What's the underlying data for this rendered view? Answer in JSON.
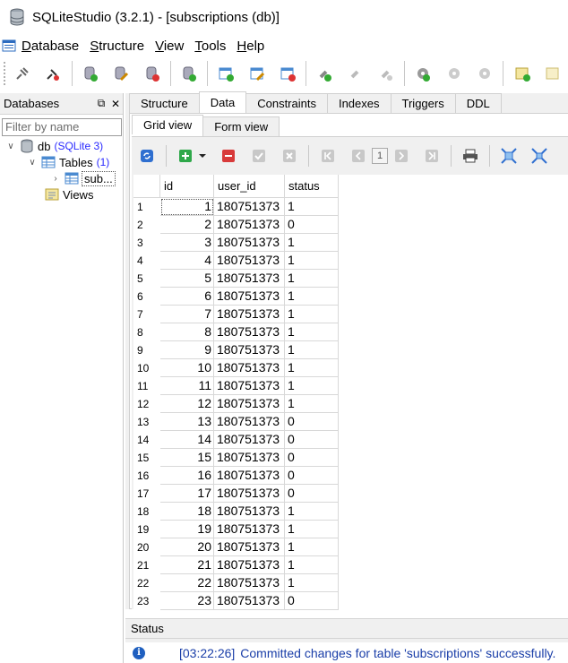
{
  "window": {
    "title": "SQLiteStudio (3.2.1) - [subscriptions (db)]"
  },
  "menu": [
    {
      "mn": "D",
      "rest": "atabase"
    },
    {
      "mn": "S",
      "rest": "tructure"
    },
    {
      "mn": "V",
      "rest": "iew"
    },
    {
      "mn": "T",
      "rest": "ools"
    },
    {
      "mn": "H",
      "rest": "elp"
    }
  ],
  "databases_panel": {
    "title": "Databases",
    "filter_placeholder": "Filter by name",
    "tree": {
      "db_name": "db",
      "db_type": "(SQLite 3)",
      "tables_label": "Tables",
      "tables_count": "(1)",
      "table_item": "sub...",
      "views_label": "Views"
    }
  },
  "tabs": [
    "Structure",
    "Data",
    "Constraints",
    "Indexes",
    "Triggers",
    "DDL"
  ],
  "active_tab": "Data",
  "inner_tabs": [
    "Grid view",
    "Form view"
  ],
  "grid_toolbar": {
    "page": "1"
  },
  "grid": {
    "columns": [
      "id",
      "user_id",
      "status"
    ],
    "rows": [
      [
        "1",
        "1",
        "180751373",
        "1"
      ],
      [
        "2",
        "2",
        "180751373",
        "0"
      ],
      [
        "3",
        "3",
        "180751373",
        "1"
      ],
      [
        "4",
        "4",
        "180751373",
        "1"
      ],
      [
        "5",
        "5",
        "180751373",
        "1"
      ],
      [
        "6",
        "6",
        "180751373",
        "1"
      ],
      [
        "7",
        "7",
        "180751373",
        "1"
      ],
      [
        "8",
        "8",
        "180751373",
        "1"
      ],
      [
        "9",
        "9",
        "180751373",
        "1"
      ],
      [
        "10",
        "10",
        "180751373",
        "1"
      ],
      [
        "11",
        "11",
        "180751373",
        "1"
      ],
      [
        "12",
        "12",
        "180751373",
        "1"
      ],
      [
        "13",
        "13",
        "180751373",
        "0"
      ],
      [
        "14",
        "14",
        "180751373",
        "0"
      ],
      [
        "15",
        "15",
        "180751373",
        "0"
      ],
      [
        "16",
        "16",
        "180751373",
        "0"
      ],
      [
        "17",
        "17",
        "180751373",
        "0"
      ],
      [
        "18",
        "18",
        "180751373",
        "1"
      ],
      [
        "19",
        "19",
        "180751373",
        "1"
      ],
      [
        "20",
        "20",
        "180751373",
        "1"
      ],
      [
        "21",
        "21",
        "180751373",
        "1"
      ],
      [
        "22",
        "22",
        "180751373",
        "1"
      ],
      [
        "23",
        "23",
        "180751373",
        "0"
      ]
    ]
  },
  "status": {
    "title": "Status",
    "time": "[03:22:26]",
    "message": "Committed changes for table 'subscriptions' successfully."
  }
}
